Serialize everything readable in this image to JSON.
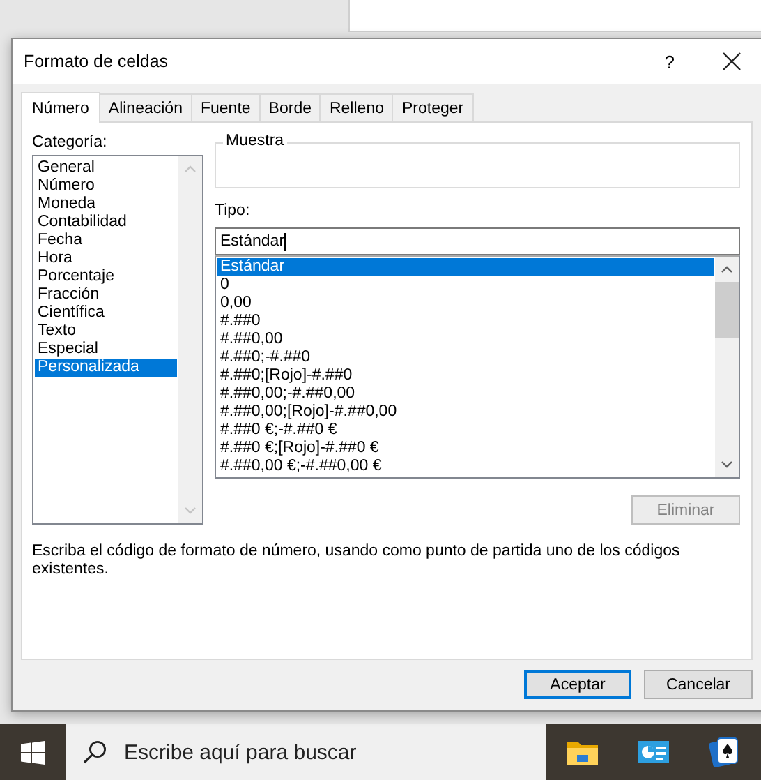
{
  "window": {
    "title": "Formato de celdas",
    "help": "?"
  },
  "tabs": [
    {
      "label": "Número",
      "selected": true
    },
    {
      "label": "Alineación",
      "selected": false
    },
    {
      "label": "Fuente",
      "selected": false
    },
    {
      "label": "Borde",
      "selected": false
    },
    {
      "label": "Relleno",
      "selected": false
    },
    {
      "label": "Proteger",
      "selected": false
    }
  ],
  "category": {
    "label": "Categoría:",
    "items": [
      {
        "label": "General",
        "selected": false
      },
      {
        "label": "Número",
        "selected": false
      },
      {
        "label": "Moneda",
        "selected": false
      },
      {
        "label": "Contabilidad",
        "selected": false
      },
      {
        "label": "Fecha",
        "selected": false
      },
      {
        "label": "Hora",
        "selected": false
      },
      {
        "label": "Porcentaje",
        "selected": false
      },
      {
        "label": "Fracción",
        "selected": false
      },
      {
        "label": "Científica",
        "selected": false
      },
      {
        "label": "Texto",
        "selected": false
      },
      {
        "label": "Especial",
        "selected": false
      },
      {
        "label": "Personalizada",
        "selected": true
      }
    ]
  },
  "sample": {
    "label": "Muestra"
  },
  "type": {
    "label": "Tipo:",
    "value": "Estándar",
    "items": [
      {
        "label": "Estándar",
        "selected": true
      },
      {
        "label": "0",
        "selected": false
      },
      {
        "label": "0,00",
        "selected": false
      },
      {
        "label": "#.##0",
        "selected": false
      },
      {
        "label": "#.##0,00",
        "selected": false
      },
      {
        "label": "#.##0;-#.##0",
        "selected": false
      },
      {
        "label": "#.##0;[Rojo]-#.##0",
        "selected": false
      },
      {
        "label": "#.##0,00;-#.##0,00",
        "selected": false
      },
      {
        "label": "#.##0,00;[Rojo]-#.##0,00",
        "selected": false
      },
      {
        "label": "#.##0 €;-#.##0 €",
        "selected": false
      },
      {
        "label": "#.##0 €;[Rojo]-#.##0 €",
        "selected": false
      },
      {
        "label": "#.##0,00 €;-#.##0,00 €",
        "selected": false
      }
    ]
  },
  "delete_button": {
    "label": "Eliminar",
    "disabled": true
  },
  "description": "Escriba el código de formato de número, usando como punto de partida uno de los códigos existentes.",
  "buttons": [
    {
      "label": "Aceptar",
      "default": true
    },
    {
      "label": "Cancelar",
      "default": false
    }
  ],
  "taskbar": {
    "search": {
      "placeholder": "Escribe aquí para buscar"
    }
  }
}
